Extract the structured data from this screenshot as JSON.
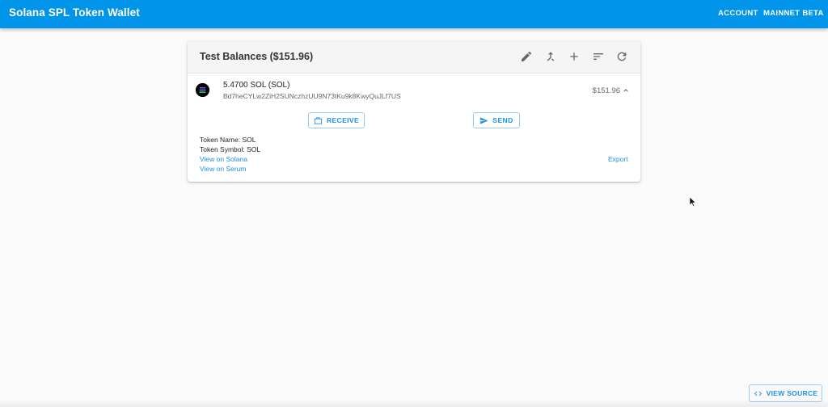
{
  "appbar": {
    "title": "Solana SPL Token Wallet",
    "account_label": "ACCOUNT",
    "network_label": "MAINNET BETA",
    "color": "#0094ea"
  },
  "balances": {
    "title": "Test Balances ($151.96)",
    "icons": [
      "edit-icon",
      "merge-icon",
      "add-icon",
      "sort-icon",
      "refresh-icon"
    ],
    "token": {
      "amount": "5.4700 SOL (SOL)",
      "address": "Bd7heCYLw2ZiH2SUNczhzUU9N73tKu9k8KwyQuJLf7US",
      "value": "$151.96",
      "receive_label": "RECEIVE",
      "send_label": "SEND",
      "token_name": "Token Name: SOL",
      "token_symbol": "Token Symbol: SOL",
      "view_solana": "View on Solana",
      "view_serum": "View on Serum",
      "export": "Export"
    }
  },
  "footer": {
    "view_source_label": "VIEW SOURCE"
  }
}
